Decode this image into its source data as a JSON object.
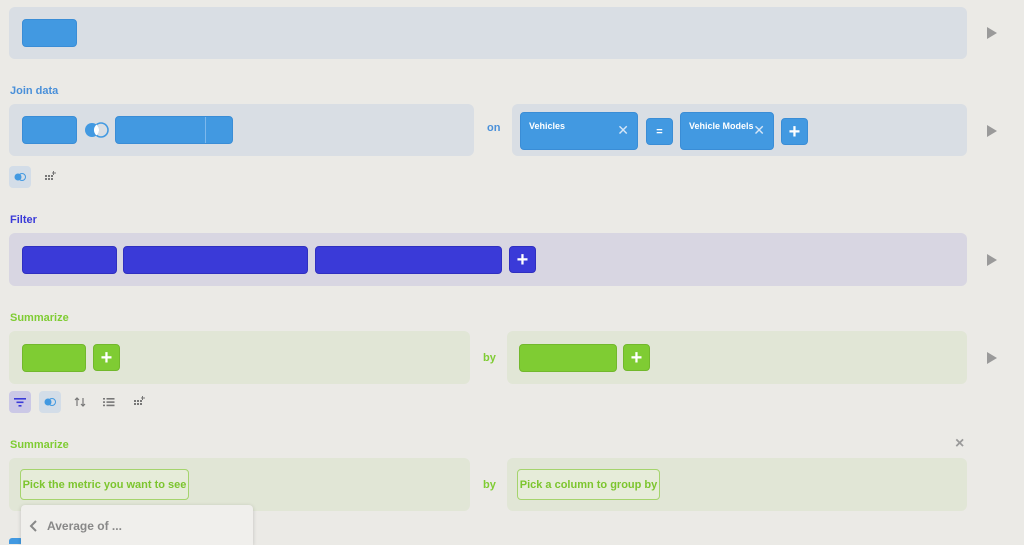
{
  "data_step": {},
  "join": {
    "title": "Join data",
    "on_label": "on",
    "left_column": "Vehicles",
    "equals_label": "=",
    "right_column": "Vehicle Models",
    "add_label": "+"
  },
  "filter": {
    "title": "Filter",
    "add_label": "+"
  },
  "summarize": {
    "title": "Summarize",
    "by_label": "by",
    "add_metric_label": "+",
    "add_group_label": "+"
  },
  "summarize_new": {
    "title": "Summarize",
    "by_label": "by",
    "metric_placeholder": "Pick the metric you want to see",
    "group_placeholder": "Pick a column to group by",
    "close_label": "×"
  },
  "popover": {
    "back_label": "Average of ..."
  },
  "colors": {
    "data_blue": "#4299e1",
    "filter_indigo": "#3a3ad8",
    "summarize_green": "#7fcc33",
    "panel_blue": "#d9dee4",
    "panel_filter": "#d8d6e2",
    "panel_green": "#e1e6d6",
    "background": "#ebeae6"
  }
}
